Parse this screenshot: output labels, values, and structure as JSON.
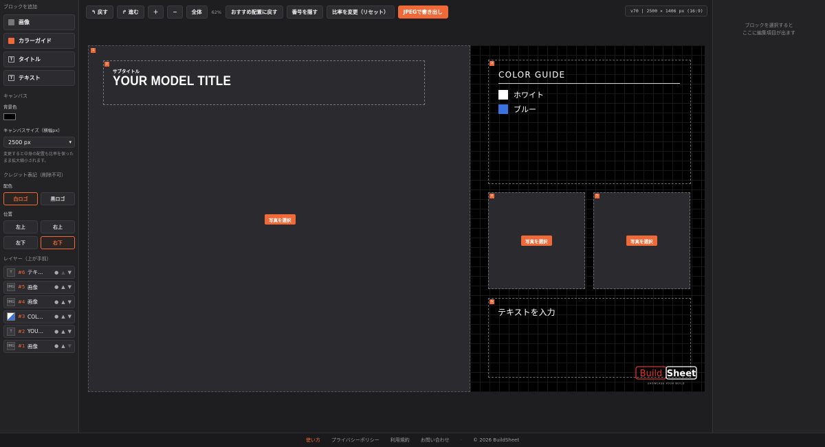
{
  "sidebar": {
    "add_title": "ブロックを追加",
    "add_buttons": [
      {
        "label": "画像",
        "icon": "image-icon"
      },
      {
        "label": "カラーガイド",
        "icon": "color-guide-icon"
      },
      {
        "label": "タイトル",
        "icon": "title-icon"
      },
      {
        "label": "テキスト",
        "icon": "text-icon"
      }
    ],
    "canvas_title": "キャンバス",
    "bg_label": "背景色",
    "bg_color": "#000000",
    "size_label": "キャンバスサイズ（横幅px）",
    "size_value": "2500 px",
    "size_note": "変更すると中身の配置も比率を保ったまま拡大縮小されます。",
    "credit_title": "クレジット表記（削除不可）",
    "scheme_label": "配色",
    "scheme_options": [
      "白ロゴ",
      "黒ロゴ"
    ],
    "position_label": "位置",
    "position_options": [
      "左上",
      "右上",
      "左下",
      "右下"
    ],
    "layers_title": "レイヤー（上が手前）",
    "layers": [
      {
        "type": "T",
        "num": "#6",
        "name": "テキ…"
      },
      {
        "type": "IMG",
        "num": "#5",
        "name": "画像"
      },
      {
        "type": "IMG",
        "num": "#4",
        "name": "画像"
      },
      {
        "type": "",
        "num": "#3",
        "name": "COL…"
      },
      {
        "type": "T",
        "num": "#2",
        "name": "YOU…"
      },
      {
        "type": "IMG",
        "num": "#1",
        "name": "画像"
      }
    ]
  },
  "toolbar": {
    "undo": "↰ 戻す",
    "redo": "↱ 進む",
    "zoom_in": "＋",
    "zoom_out": "−",
    "fit": "全体",
    "zoom_level": "62%",
    "reset_layout": "おすすめ配置に戻す",
    "hide_numbers": "番号を隠す",
    "change_ratio": "比率を変更（リセット）",
    "export": "JPEGで書き出し",
    "size_info": "v70 | 2500 × 1406 px (16:9)"
  },
  "right_panel": {
    "hint_line1": "ブロックを選択すると",
    "hint_line2": "ここに編集項目が出ます"
  },
  "canvas": {
    "block_numbers": [
      "1",
      "2",
      "3",
      "4",
      "5",
      "6"
    ],
    "subtitle": "サブタイトル",
    "title": "YOUR MODEL TITLE",
    "photo_button": "写真を選択",
    "color_guide_title": "COLOR GUIDE",
    "colors": [
      {
        "name": "ホワイト",
        "color": "#ffffff"
      },
      {
        "name": "ブルー",
        "color": "#3a73e0"
      }
    ],
    "text_placeholder": "テキストを入力",
    "logo_build": "Build",
    "logo_sheet": "Sheet",
    "logo_tagline": "SHOWCASE YOUR BUILD"
  },
  "footer": {
    "links": [
      "使い方",
      "プライバシーポリシー",
      "利用規約",
      "お問い合わせ"
    ],
    "copyright": "© 2026 BuildSheet"
  },
  "colors": {
    "accent": "#ef6a38",
    "logo_red": "#e0322b"
  }
}
